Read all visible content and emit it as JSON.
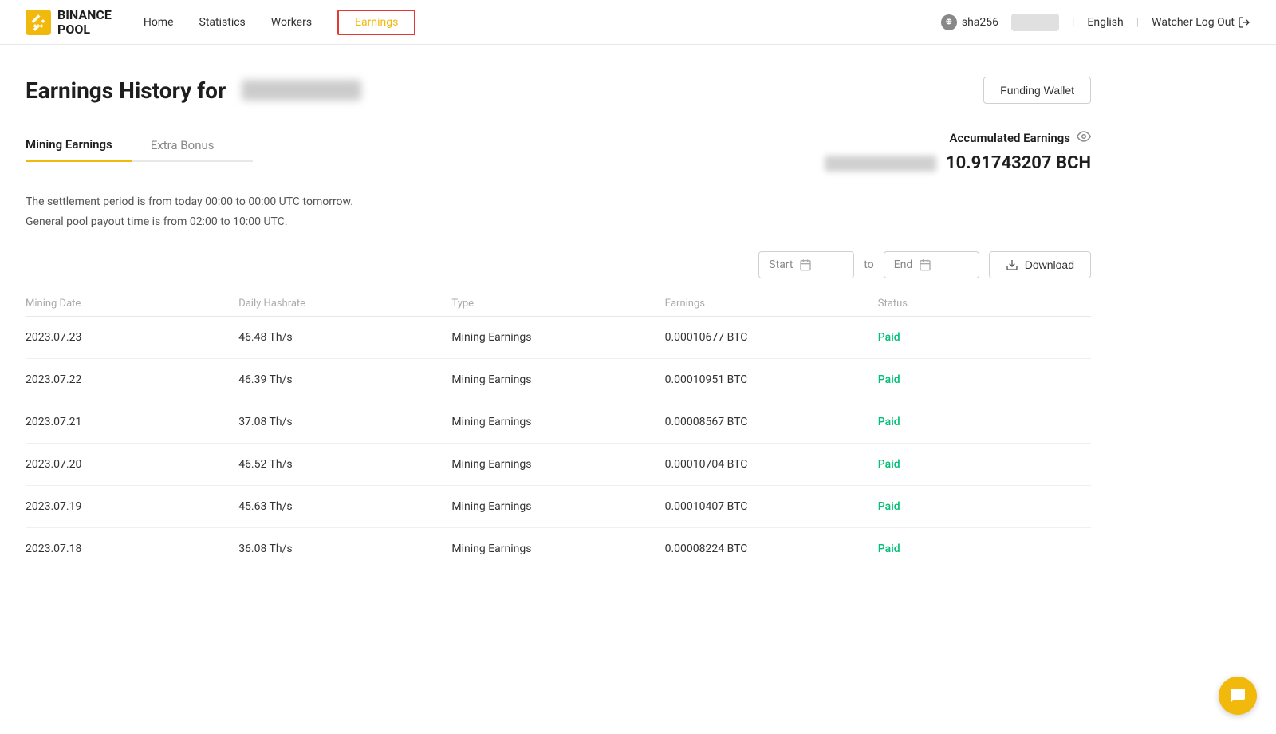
{
  "header": {
    "logo_line1": "BINANCE",
    "logo_line2": "POOL",
    "nav": [
      {
        "label": "Home",
        "id": "home",
        "active": false
      },
      {
        "label": "Statistics",
        "id": "statistics",
        "active": false
      },
      {
        "label": "Workers",
        "id": "workers",
        "active": false
      },
      {
        "label": "Earnings",
        "id": "earnings",
        "active": true
      }
    ],
    "algo": "sha256",
    "language": "English",
    "logout": "Watcher Log Out"
  },
  "page": {
    "title": "Earnings History for",
    "funding_wallet_btn": "Funding Wallet"
  },
  "tabs": [
    {
      "label": "Mining Earnings",
      "active": true
    },
    {
      "label": "Extra Bonus",
      "active": false
    }
  ],
  "accumulated": {
    "label": "Accumulated Earnings",
    "value": "10.91743207 BCH"
  },
  "info": {
    "line1": "The settlement period is from today 00:00 to 00:00 UTC tomorrow.",
    "line2": "General pool payout time is from 02:00 to 10:00 UTC."
  },
  "filter": {
    "start_placeholder": "Start",
    "end_placeholder": "End",
    "separator": "to",
    "download_btn": "Download"
  },
  "table": {
    "headers": [
      "Mining Date",
      "Daily Hashrate",
      "Type",
      "Earnings",
      "Status"
    ],
    "rows": [
      {
        "date": "2023.07.23",
        "hashrate": "46.48 Th/s",
        "type": "Mining Earnings",
        "earnings": "0.00010677 BTC",
        "status": "Paid"
      },
      {
        "date": "2023.07.22",
        "hashrate": "46.39 Th/s",
        "type": "Mining Earnings",
        "earnings": "0.00010951 BTC",
        "status": "Paid"
      },
      {
        "date": "2023.07.21",
        "hashrate": "37.08 Th/s",
        "type": "Mining Earnings",
        "earnings": "0.00008567 BTC",
        "status": "Paid"
      },
      {
        "date": "2023.07.20",
        "hashrate": "46.52 Th/s",
        "type": "Mining Earnings",
        "earnings": "0.00010704 BTC",
        "status": "Paid"
      },
      {
        "date": "2023.07.19",
        "hashrate": "45.63 Th/s",
        "type": "Mining Earnings",
        "earnings": "0.00010407 BTC",
        "status": "Paid"
      },
      {
        "date": "2023.07.18",
        "hashrate": "36.08 Th/s",
        "type": "Mining Earnings",
        "earnings": "0.00008224 BTC",
        "status": "Paid"
      }
    ]
  },
  "colors": {
    "accent": "#f0b90b",
    "paid": "#02c076",
    "active_nav_border": "#e53935"
  }
}
